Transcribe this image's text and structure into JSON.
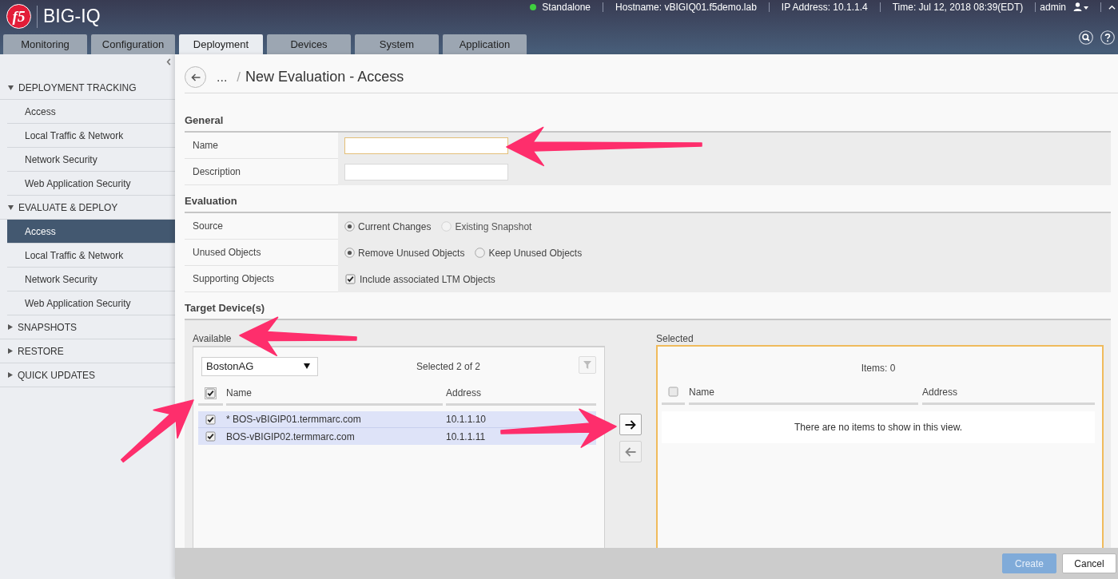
{
  "header": {
    "logo": "f5",
    "product": "BIG-IQ",
    "status_items": [
      "Standalone",
      "Hostname: vBIGIQ01.f5demo.lab",
      "IP Address: 10.1.1.4",
      "Time: Jul 12, 2018 08:39(EDT)"
    ],
    "user": "admin"
  },
  "nav_tabs": [
    {
      "label": "Monitoring",
      "selected": false
    },
    {
      "label": "Configuration",
      "selected": false
    },
    {
      "label": "Deployment",
      "selected": true
    },
    {
      "label": "Devices",
      "selected": false
    },
    {
      "label": "System",
      "selected": false
    },
    {
      "label": "Application",
      "selected": false
    }
  ],
  "sidebar": {
    "sections": [
      {
        "title": "DEPLOYMENT TRACKING",
        "expanded": true,
        "items": [
          {
            "label": "Access",
            "selected": false
          },
          {
            "label": "Local Traffic & Network",
            "selected": false
          },
          {
            "label": "Network Security",
            "selected": false
          },
          {
            "label": "Web Application Security",
            "selected": false
          }
        ]
      },
      {
        "title": "EVALUATE & DEPLOY",
        "expanded": true,
        "items": [
          {
            "label": "Access",
            "selected": true
          },
          {
            "label": "Local Traffic & Network",
            "selected": false
          },
          {
            "label": "Network Security",
            "selected": false
          },
          {
            "label": "Web Application Security",
            "selected": false
          }
        ]
      },
      {
        "title": "SNAPSHOTS",
        "expanded": false
      },
      {
        "title": "RESTORE",
        "expanded": false
      },
      {
        "title": "QUICK UPDATES",
        "expanded": false
      }
    ]
  },
  "page": {
    "breadcrumb": "...",
    "separator": "/",
    "title": "New Evaluation - Access"
  },
  "general": {
    "heading": "General",
    "fields": [
      {
        "label": "Name",
        "focused": true
      },
      {
        "label": "Description",
        "focused": false
      }
    ]
  },
  "evaluation": {
    "heading": "Evaluation",
    "rows": [
      {
        "label": "Source",
        "kind": "radio",
        "options": [
          {
            "label": "Current Changes",
            "selected": true,
            "disabled": false
          },
          {
            "label": "Existing Snapshot",
            "selected": false,
            "disabled": true
          }
        ]
      },
      {
        "label": "Unused Objects",
        "kind": "radio",
        "options": [
          {
            "label": "Remove Unused Objects",
            "selected": true,
            "disabled": false
          },
          {
            "label": "Keep Unused Objects",
            "selected": false,
            "disabled": false
          }
        ]
      },
      {
        "label": "Supporting Objects",
        "kind": "checkbox",
        "options": [
          {
            "label": "Include associated LTM Objects",
            "checked": true
          }
        ]
      }
    ]
  },
  "target_devices": {
    "heading": "Target Device(s)",
    "available": {
      "label": "Available",
      "group": "BostonAG",
      "summary": "Selected 2 of 2",
      "header_checkbox": {
        "checked": true,
        "focused": true
      },
      "columns": [
        "Name",
        "Address"
      ],
      "rows": [
        {
          "name": "* BOS-vBIGIP01.termmarc.com",
          "address": "10.1.1.10",
          "checked": true,
          "selected": true
        },
        {
          "name": "BOS-vBIGIP02.termmarc.com",
          "address": "10.1.1.11",
          "checked": true,
          "selected": true
        }
      ]
    },
    "transfer_buttons": [
      {
        "kind": "move_right",
        "disabled": false
      },
      {
        "kind": "move_left",
        "disabled": true
      }
    ],
    "selected": {
      "label": "Selected",
      "summary": "Items: 0",
      "focused": true,
      "header_checkbox": {
        "checked": false,
        "focused": false
      },
      "columns": [
        "Name",
        "Address"
      ],
      "empty_message": "There are no items to show in this view."
    }
  },
  "footer": {
    "buttons": [
      {
        "label": "Create",
        "kind": "primary",
        "disabled": true
      },
      {
        "label": "Cancel",
        "kind": "secondary",
        "disabled": false
      }
    ]
  }
}
